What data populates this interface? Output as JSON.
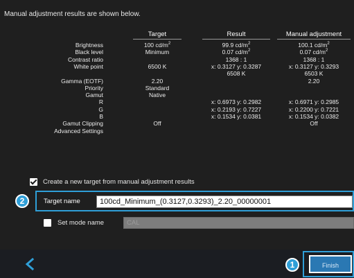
{
  "intro_text": "Manual adjustment results are shown below.",
  "table": {
    "headers": {
      "target": "Target",
      "result": "Result",
      "manual": "Manual adjustment"
    },
    "rows": [
      {
        "label": "Brightness",
        "target": "100 cd/m",
        "target_sup": "2",
        "result": "99.9 cd/m",
        "result_sup": "2",
        "manual": "100.1 cd/m",
        "manual_sup": "2"
      },
      {
        "label": "Black level",
        "target": "Minimum",
        "target_sup": "",
        "result": "0.07 cd/m",
        "result_sup": "2",
        "manual": "0.07 cd/m",
        "manual_sup": "2"
      },
      {
        "label": "Contrast ratio",
        "target": "",
        "target_sup": "",
        "result": "1368 : 1",
        "result_sup": "",
        "manual": "1368 : 1",
        "manual_sup": ""
      },
      {
        "label": "White point",
        "target": "6500 K",
        "target_sup": "",
        "result": "x: 0.3127  y: 0.3287",
        "result_sup": "",
        "manual": "x: 0.3127  y: 0.3293",
        "manual_sup": ""
      },
      {
        "label": "",
        "target": "",
        "target_sup": "",
        "result": "6508 K",
        "result_sup": "",
        "manual": "6503 K",
        "manual_sup": ""
      },
      {
        "label": "Gamma (EOTF)",
        "target": "2.20",
        "target_sup": "",
        "result": "",
        "result_sup": "",
        "manual": "2.20",
        "manual_sup": ""
      },
      {
        "label": "Priority",
        "target": "Standard",
        "target_sup": "",
        "result": "",
        "result_sup": "",
        "manual": "",
        "manual_sup": ""
      },
      {
        "label": "Gamut",
        "target": "Native",
        "target_sup": "",
        "result": "",
        "result_sup": "",
        "manual": "",
        "manual_sup": ""
      },
      {
        "label": "R",
        "target": "",
        "target_sup": "",
        "result": "x: 0.6973  y: 0.2982",
        "result_sup": "",
        "manual": "x: 0.6971  y: 0.2985",
        "manual_sup": ""
      },
      {
        "label": "G",
        "target": "",
        "target_sup": "",
        "result": "x: 0.2193  y: 0.7227",
        "result_sup": "",
        "manual": "x: 0.2200  y: 0.7221",
        "manual_sup": ""
      },
      {
        "label": "B",
        "target": "",
        "target_sup": "",
        "result": "x: 0.1534  y: 0.0381",
        "result_sup": "",
        "manual": "x: 0.1534  y: 0.0382",
        "manual_sup": ""
      },
      {
        "label": "Gamut Clipping",
        "target": "Off",
        "target_sup": "",
        "result": "",
        "result_sup": "",
        "manual": "Off",
        "manual_sup": ""
      },
      {
        "label": "Advanced Settings",
        "target": "",
        "target_sup": "",
        "result": "",
        "result_sup": "",
        "manual": "",
        "manual_sup": ""
      }
    ]
  },
  "create_target": {
    "label": "Create a new target from manual adjustment results",
    "checked": true
  },
  "target_name": {
    "label": "Target name",
    "value": "100cd_Minimum_(0.3127,0.3293)_2.20_00000001"
  },
  "set_mode_name": {
    "label": "Set mode name",
    "checked": false,
    "placeholder": "CAL"
  },
  "callouts": {
    "target_name": "2",
    "finish": "1"
  },
  "footer": {
    "back_icon": "chevron-left-icon",
    "finish_label": "Finish"
  },
  "colors": {
    "accent": "#2f9fd8",
    "finish_button": "#2a78b3",
    "background": "#1f1f1f"
  }
}
